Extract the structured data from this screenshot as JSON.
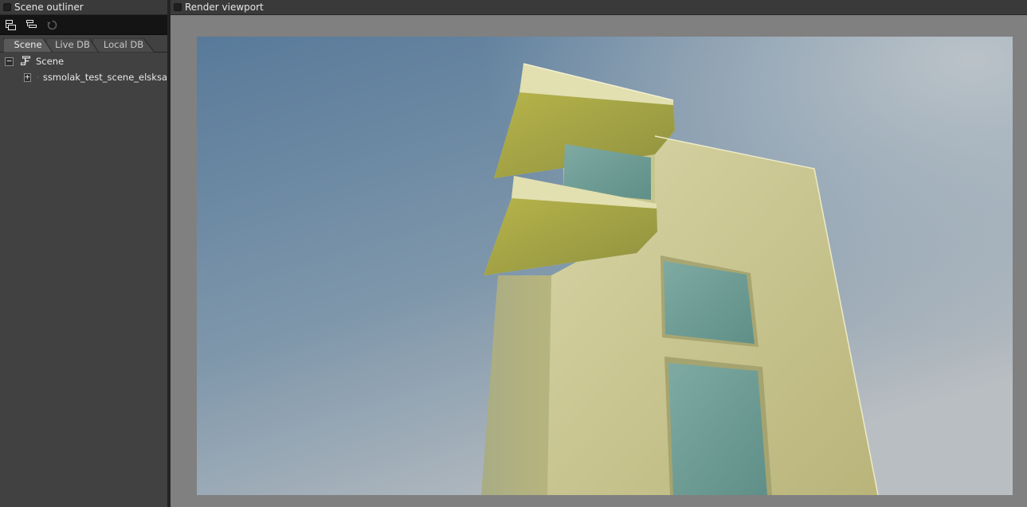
{
  "outliner": {
    "title": "Scene outliner",
    "toolbar": {
      "icons": [
        "expand-all-icon",
        "collapse-all-icon",
        "refresh-icon"
      ]
    },
    "tabs": [
      {
        "label": "Scene",
        "active": true
      },
      {
        "label": "Live DB",
        "active": false
      },
      {
        "label": "Local DB",
        "active": false
      }
    ],
    "tree": [
      {
        "label": "Scene",
        "toggle": "−",
        "expanded": true,
        "icon": "scene-node-icon"
      },
      {
        "label": "ssmolak_test_scene_elsksa",
        "toggle": "+",
        "expanded": false,
        "icon": "scene-node-icon"
      }
    ]
  },
  "viewport": {
    "title": "Render viewport"
  },
  "colors": {
    "panel_bg": "#414141",
    "toolbar_bg": "#141414",
    "viewport_bg": "#808080",
    "sky_top": "#5e7f9e",
    "sky_bottom": "#b8bfc4",
    "building_wall": "#c9c58e",
    "building_shadow": "#a9a56d",
    "window_glass": "#6e9e96"
  }
}
